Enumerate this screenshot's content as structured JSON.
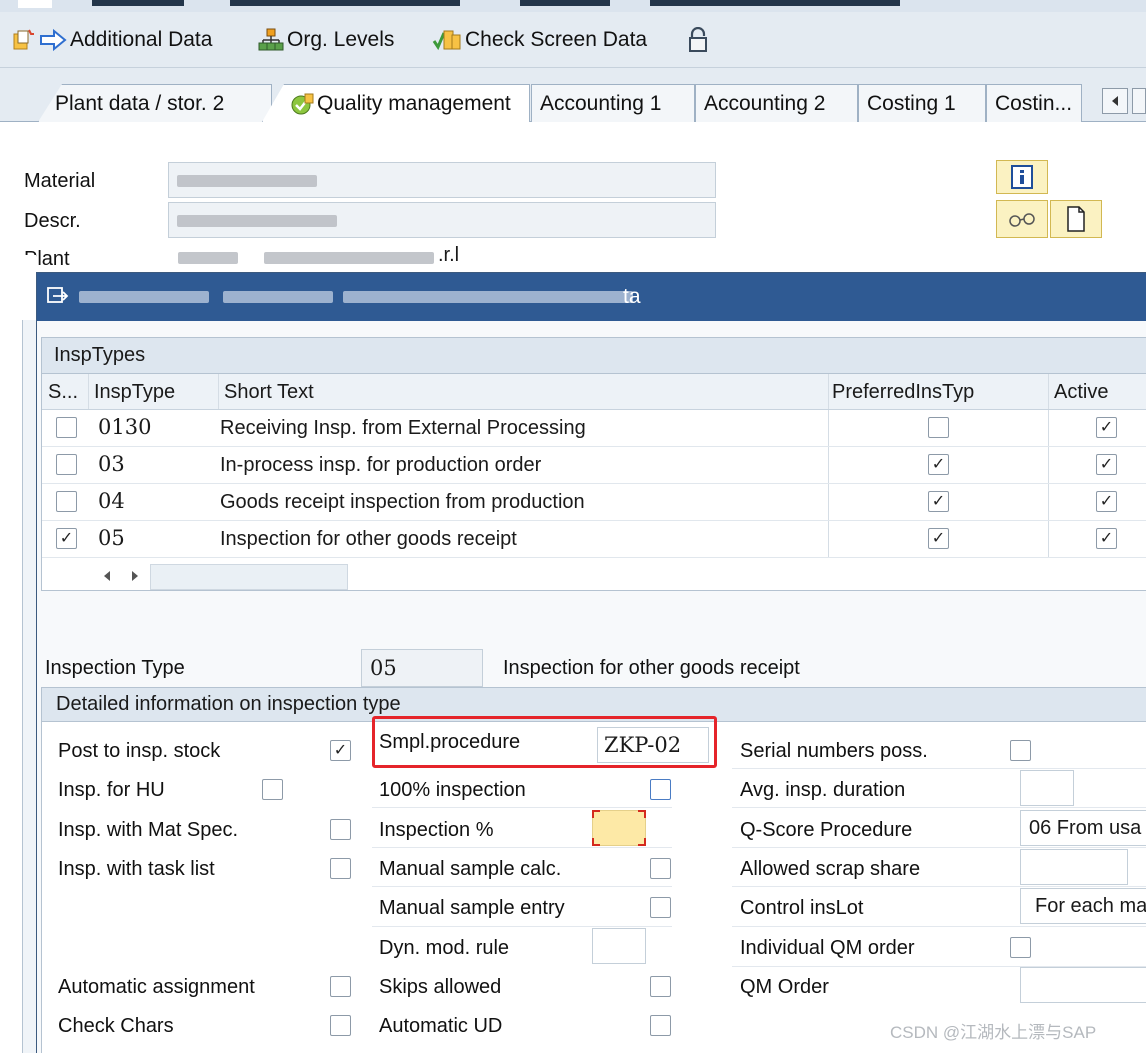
{
  "toolbar": {
    "additional_data": "Additional Data",
    "org_levels": "Org. Levels",
    "check_screen_data": "Check Screen Data"
  },
  "tabs": {
    "t1": "Plant data / stor. 2",
    "t2": "Quality management",
    "t3": "Accounting 1",
    "t4": "Accounting 2",
    "t5": "Costing 1",
    "t6": "Costin..."
  },
  "header": {
    "material_label": "Material",
    "descr_label": "Descr.",
    "plant_label": "Plant",
    "plant_suffix": ".r.l"
  },
  "dialog": {
    "title_suffix": "ta",
    "table": {
      "title": "InspTypes",
      "columns": [
        "S...",
        "InspType",
        "Short Text",
        "PreferredInsTyp",
        "Active"
      ],
      "rows": [
        {
          "selected": false,
          "code": "0130",
          "text": "Receiving Insp. from External Processing",
          "preferred": false,
          "active": true
        },
        {
          "selected": false,
          "code": "03",
          "text": "In-process insp. for production order",
          "preferred": true,
          "active": true
        },
        {
          "selected": false,
          "code": "04",
          "text": "Goods receipt inspection from production",
          "preferred": true,
          "active": true
        },
        {
          "selected": true,
          "code": "05",
          "text": "Inspection for other goods receipt",
          "preferred": true,
          "active": true
        }
      ]
    },
    "insp_type_label": "Inspection Type",
    "insp_type_value": "05",
    "insp_type_text": "Inspection for other goods receipt",
    "detail": {
      "title": "Detailed information on inspection type",
      "col1": [
        {
          "label": "Post to insp. stock",
          "checked": true
        },
        {
          "label": "Insp. for HU",
          "checked": false
        },
        {
          "label": "Insp. with Mat Spec.",
          "checked": false
        },
        {
          "label": "Insp. with task list",
          "checked": false
        },
        {
          "label": "Automatic assignment",
          "checked": false
        },
        {
          "label": "Check Chars",
          "checked": false
        }
      ],
      "col2": {
        "smpl_label": "Smpl.procedure",
        "smpl_value": "ZKP-02",
        "full_insp_label": "100% inspection",
        "insp_pct_label": "Inspection %",
        "manual_calc_label": "Manual sample calc.",
        "manual_entry_label": "Manual sample entry",
        "dyn_rule_label": "Dyn. mod. rule",
        "skips_label": "Skips allowed",
        "auto_ud_label": "Automatic UD"
      },
      "col3": {
        "serial_label": "Serial numbers poss.",
        "avg_dur_label": "Avg. insp. duration",
        "qscore_label": "Q-Score Procedure",
        "qscore_value": "06 From usa",
        "scrap_label": "Allowed scrap share",
        "control_label": "Control insLot",
        "control_value": "For each ma",
        "qm_order_ind_label": "Individual QM order",
        "qm_order_label": "QM Order"
      }
    }
  },
  "watermark": "CSDN @江湖水上漂与SAP",
  "colors": {
    "dialog_title": "#2f5a93",
    "highlight_frame": "#e5242a",
    "required_field": "#fde9a6"
  }
}
